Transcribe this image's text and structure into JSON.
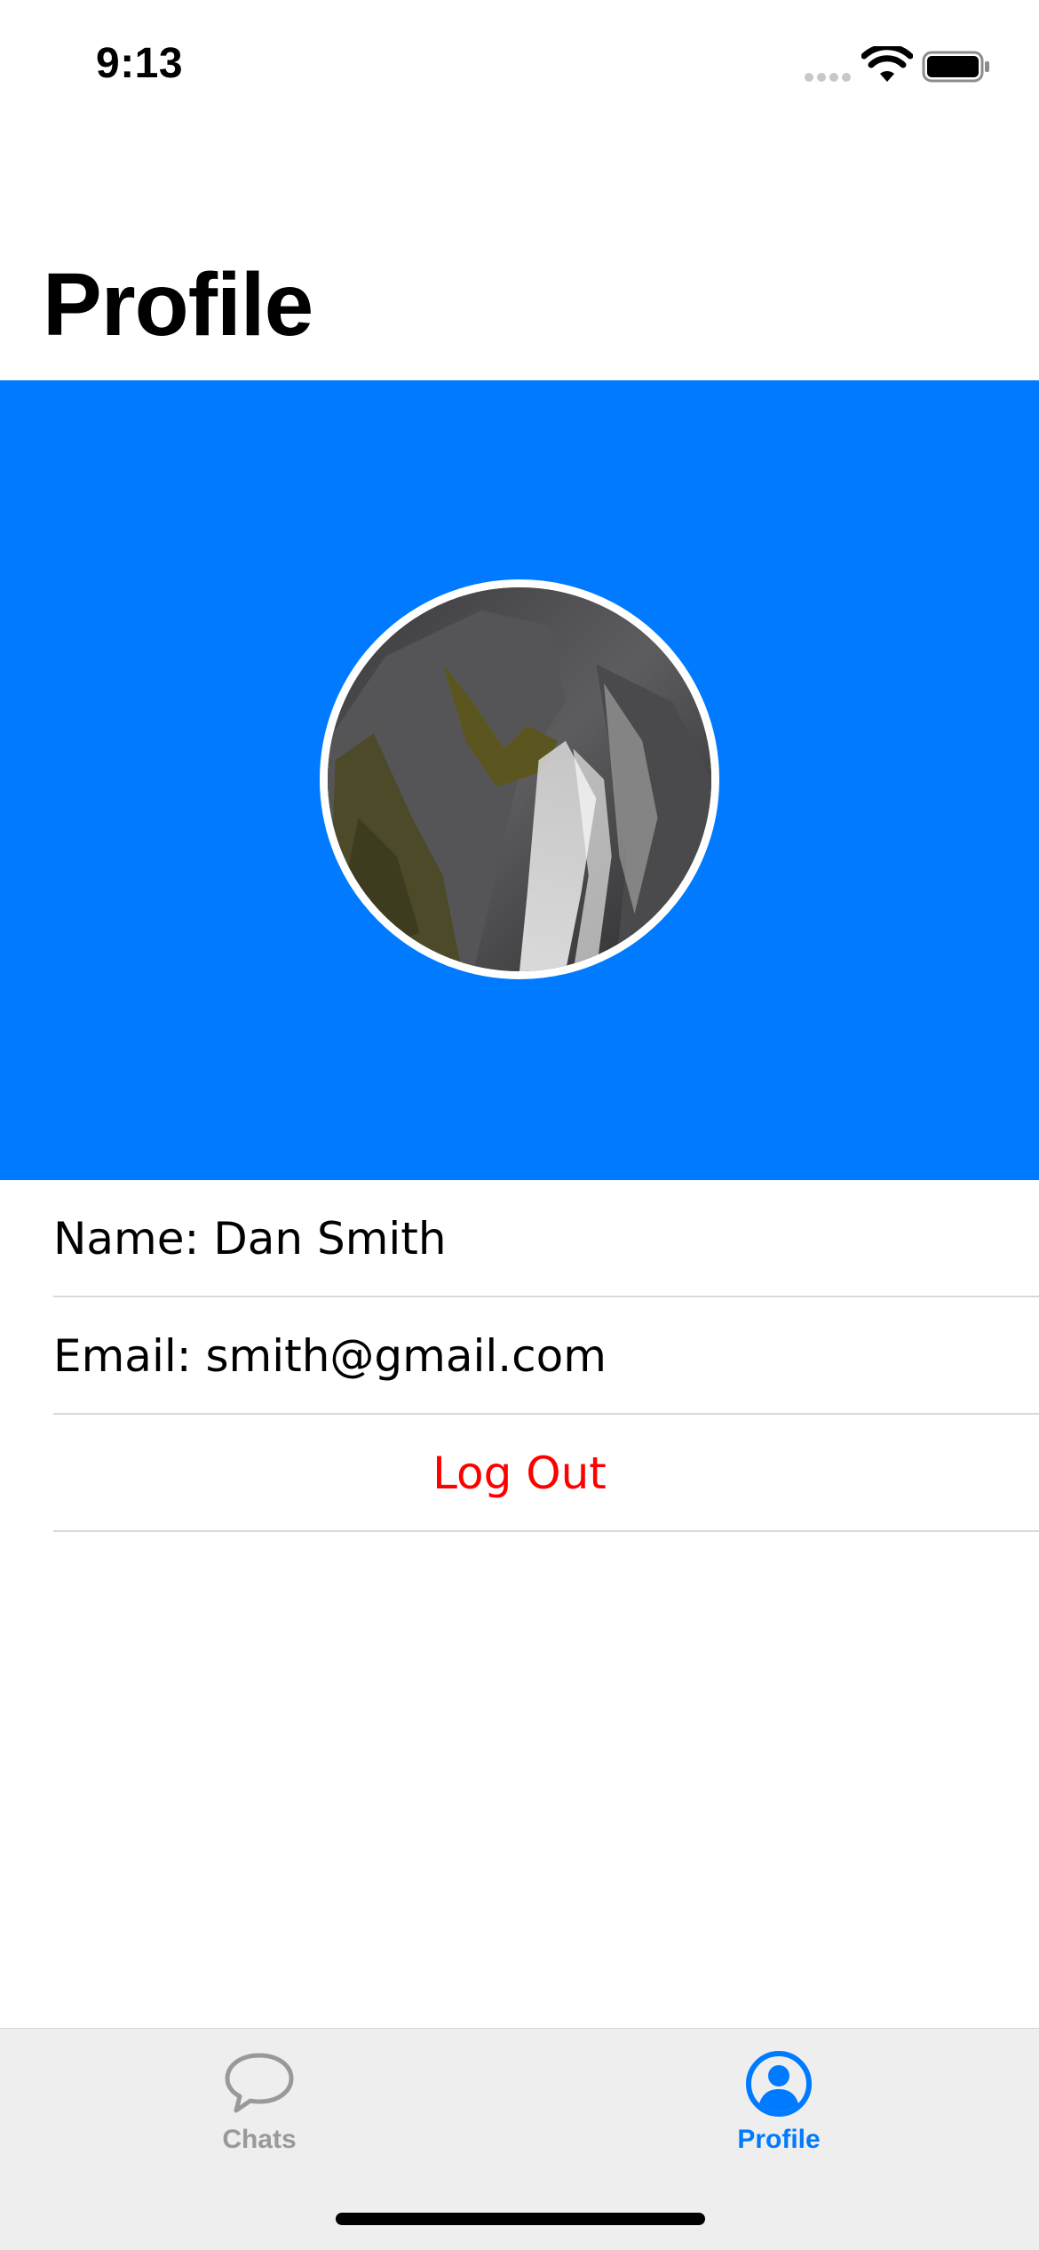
{
  "status_bar": {
    "time": "9:13",
    "signal_icon": "cellular-signal-icon",
    "wifi_icon": "wifi-icon",
    "battery_icon": "battery-icon"
  },
  "header": {
    "title": "Profile"
  },
  "profile": {
    "avatar_icon": "avatar-photo",
    "banner_color": "#007aff"
  },
  "info": {
    "name_text": "Name: Dan Smith",
    "email_text": "Email: smith@gmail.com",
    "logout_label": "Log Out",
    "logout_color": "#ff0000"
  },
  "tab_bar": {
    "tabs": [
      {
        "label": "Chats",
        "icon": "chat-bubble-icon",
        "selected": false
      },
      {
        "label": "Profile",
        "icon": "person-circle-icon",
        "selected": true
      }
    ],
    "accent_color": "#007aff",
    "inactive_color": "#999999"
  }
}
